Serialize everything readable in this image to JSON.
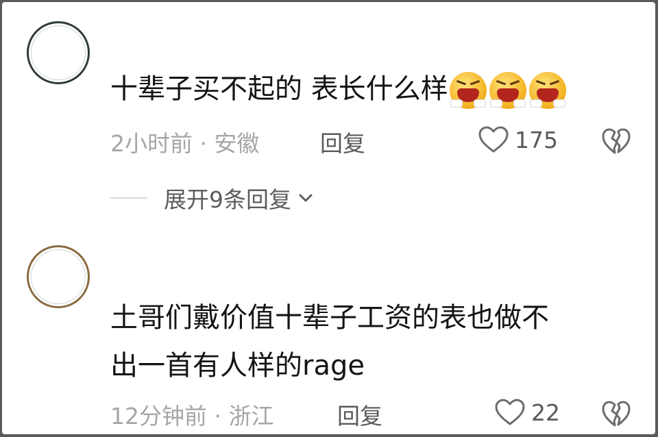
{
  "comments": [
    {
      "text": "十辈子买不起的 表长什么样",
      "emojis": [
        "crying-face-emoji",
        "crying-face-emoji",
        "crying-face-emoji"
      ],
      "time": "2小时前",
      "separator": "·",
      "location": "安徽",
      "reply_label": "回复",
      "likes": "175"
    },
    {
      "text_line1": "土哥们戴价值十辈子工资的表也做不",
      "text_line2": "出一首有人样的rage",
      "time": "12分钟前",
      "separator": "·",
      "location": "浙江",
      "reply_label": "回复",
      "likes": "22"
    }
  ],
  "expand_replies": {
    "label": "展开9条回复"
  },
  "colors": {
    "text": "#141414",
    "meta": "#a6a6a6",
    "action": "#595959",
    "background": "#ffffff"
  }
}
